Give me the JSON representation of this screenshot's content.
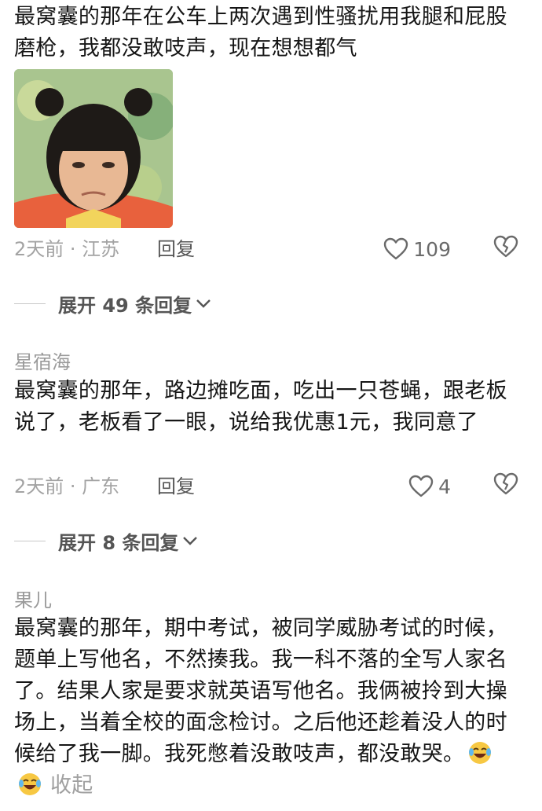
{
  "comments": [
    {
      "username": "",
      "text": "最窝囊的那年在公车上两次遇到性骚扰用我腿和屁股磨枪，我都没敢吱声，现在想想都气",
      "meta": "2天前 · 江苏",
      "reply_label": "回复",
      "likes": "109",
      "has_sticker": true,
      "expand_label": "展开 49 条回复"
    },
    {
      "username": "星宿海",
      "text": "最窝囊的那年，路边摊吃面，吃出一只苍蝇，跟老板说了，老板看了一眼，说给我优惠1元，我同意了",
      "meta": "2天前 · 广东",
      "reply_label": "回复",
      "likes": "4",
      "expand_label": "展开 8 条回复"
    },
    {
      "username": "果儿",
      "text": "最窝囊的那年，期中考试，被同学威胁考试的时候，题单上写他名，不然揍我。我一科不落的全写人家名了。结果人家是要求就英语写他名。我俩被拎到大操场上，当着全校的面念检讨。之后他还趁着没人的时候给了我一脚。我死憋着没敢吱声，都没敢哭。",
      "collapse_label": "收起",
      "emojis": [
        "laughing-crying-emoji",
        "laughing-crying-emoji"
      ]
    }
  ],
  "icons": {
    "like": "heart-outline-icon",
    "dislike": "broken-heart-icon",
    "expand": "chevron-down-icon"
  },
  "colors": {
    "text": "#161616",
    "meta": "#a3a3a3",
    "secondary": "#555555"
  }
}
